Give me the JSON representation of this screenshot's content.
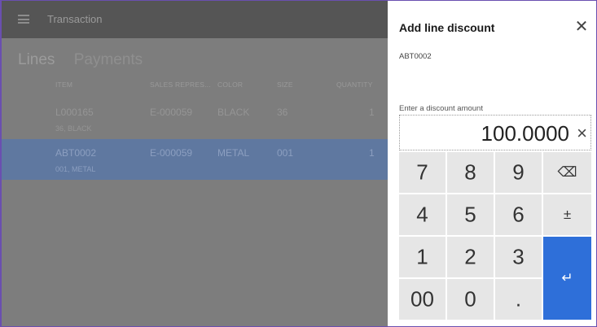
{
  "app": {
    "title": "Transaction",
    "tabs": [
      "Lines",
      "Payments"
    ],
    "columns": [
      "ITEM",
      "SALES REPRES...",
      "COLOR",
      "SIZE",
      "QUANTITY"
    ],
    "rows": [
      {
        "item": "L000165",
        "sales_rep": "E-000059",
        "color": "BLACK",
        "size": "36",
        "quantity": "1",
        "variant": "36, BLACK",
        "selected": false
      },
      {
        "item": "ABT0002",
        "sales_rep": "E-000059",
        "color": "METAL",
        "size": "001",
        "quantity": "1",
        "variant": "001, METAL",
        "selected": true
      }
    ]
  },
  "panel": {
    "title": "Add line discount",
    "close_icon": "close-icon",
    "item_code": "ABT0002",
    "amount_label": "Enter a discount amount",
    "amount_value": "100.0000",
    "clear_glyph": "×",
    "keys": {
      "k7": "7",
      "k8": "8",
      "k9": "9",
      "backspace": "⌫",
      "k4": "4",
      "k5": "5",
      "k6": "6",
      "plusminus": "±",
      "k1": "1",
      "k2": "2",
      "k3": "3",
      "enter": "↵",
      "k00": "00",
      "k0": "0",
      "dot": "."
    },
    "accent_color": "#2e6fd9"
  }
}
